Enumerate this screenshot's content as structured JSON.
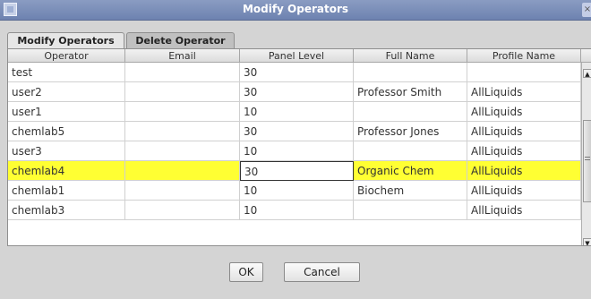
{
  "window": {
    "title": "Modify Operators",
    "close_icon": "×"
  },
  "tabs": [
    {
      "label": "Modify Operators",
      "active": true
    },
    {
      "label": "Delete Operator",
      "active": false
    }
  ],
  "table": {
    "columns": [
      "Operator",
      "Email",
      "Panel Level",
      "Full Name",
      "Profile Name"
    ],
    "rows": [
      [
        "test",
        "",
        "30",
        "",
        ""
      ],
      [
        "user2",
        "",
        "30",
        "Professor Smith",
        "AllLiquids"
      ],
      [
        "user1",
        "",
        "10",
        "",
        "AllLiquids"
      ],
      [
        "chemlab5",
        "",
        "30",
        "Professor Jones",
        "AllLiquids"
      ],
      [
        "user3",
        "",
        "10",
        "",
        "AllLiquids"
      ],
      [
        "chemlab4",
        "",
        "30",
        "Organic Chem",
        "AllLiquids"
      ],
      [
        "chemlab1",
        "",
        "10",
        "Biochem",
        "AllLiquids"
      ],
      [
        "chemlab3",
        "",
        "10",
        "",
        "AllLiquids"
      ]
    ],
    "selected_row": 5,
    "selected_color": "#ffff33"
  },
  "buttons": {
    "ok": "OK",
    "cancel": "Cancel"
  }
}
